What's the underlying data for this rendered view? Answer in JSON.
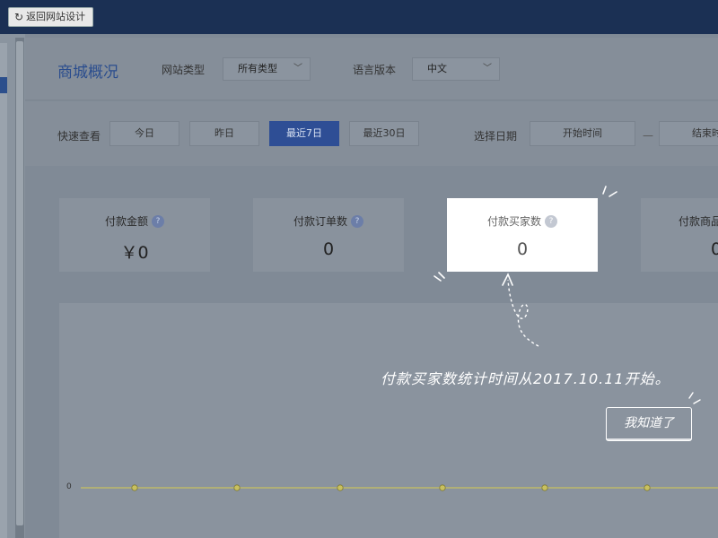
{
  "topbar": {
    "back_label": "返回网站设计"
  },
  "header": {
    "title": "商城概况",
    "site_type_label": "网站类型",
    "site_type_value": "所有类型",
    "lang_label": "语言版本",
    "lang_value": "中文"
  },
  "filter": {
    "quick_label": "快速查看",
    "buttons": [
      "今日",
      "昨日",
      "最近7日",
      "最近30日"
    ],
    "active_index": 2,
    "date_label": "选择日期",
    "start_placeholder": "开始时间",
    "separator": "—",
    "end_placeholder": "结束时"
  },
  "cards": [
    {
      "label": "付款金额",
      "value": "￥0"
    },
    {
      "label": "付款订单数",
      "value": "0"
    },
    {
      "label": "付款买家数",
      "value": "0"
    },
    {
      "label": "付款商品",
      "value": "0"
    }
  ],
  "chart": {
    "y_zero_label": "0"
  },
  "tip": {
    "text": "付款买家数统计时间从2017.10.11开始。",
    "ok_label": "我知道了"
  },
  "colors": {
    "topbar": "#1b3054",
    "accent": "#2e4e95",
    "chart_line": "#c8c060"
  },
  "icons": {
    "back": "refresh-icon",
    "help": "question-mark-icon",
    "dropdown": "chevron-down-icon"
  }
}
